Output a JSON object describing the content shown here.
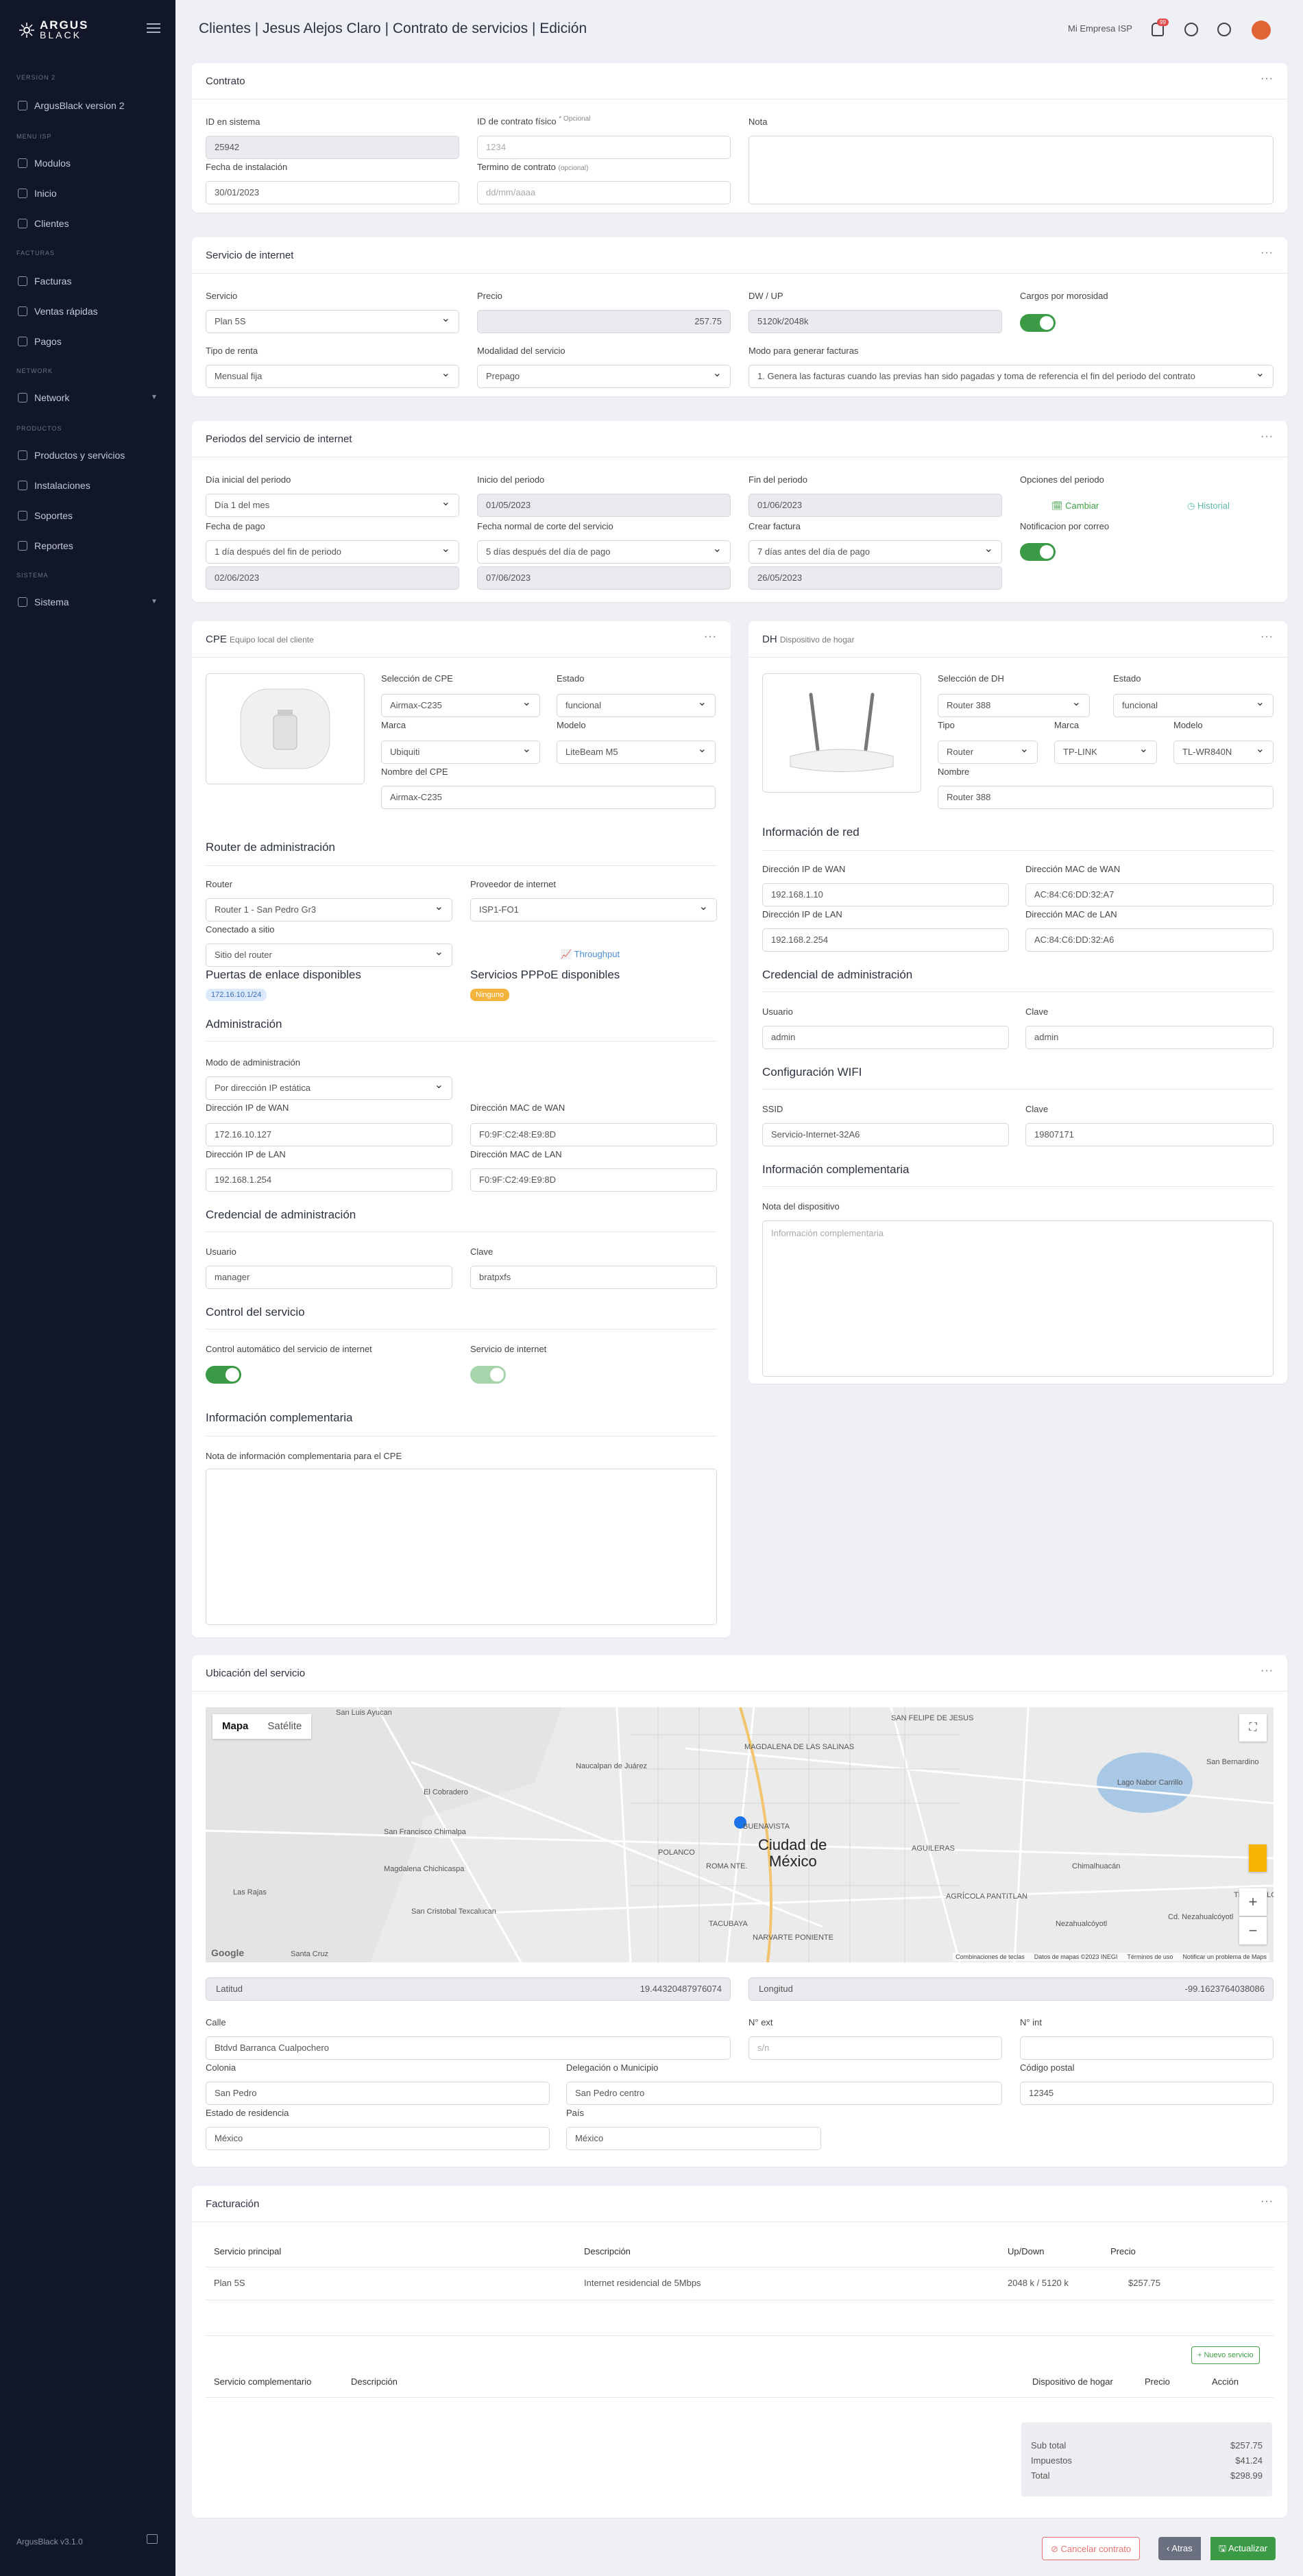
{
  "brand": {
    "name": "ARGUS",
    "sub": "BLACK"
  },
  "sidebar": {
    "sections": [
      "VERSION 2",
      "MENU ISP",
      "FACTURAS",
      "NETWORK",
      "PRODUCTOS",
      "SISTEMA"
    ],
    "items": [
      "ArgusBlack version 2",
      "Modulos",
      "Inicio",
      "Clientes",
      "Facturas",
      "Ventas rápidas",
      "Pagos",
      "Network",
      "Productos y servicios",
      "Instalaciones",
      "Soportes",
      "Reportes",
      "Sistema"
    ],
    "footer": "ArgusBlack v3.1.0"
  },
  "header": {
    "title": "Clientes | Jesus Alejos Claro | Contrato de servicios | Edición",
    "company": "Mi Empresa ISP",
    "notif_count": "99"
  },
  "contrato": {
    "title": "Contrato",
    "id_label": "ID en sistema",
    "id_value": "25942",
    "fisico_label": "ID de contrato físico",
    "fisico_opt": "* Opcional",
    "fisico_ph": "1234",
    "nota_label": "Nota",
    "fecha_label": "Fecha de instalación",
    "fecha_value": "30/01/2023",
    "termino_label": "Termino de contrato",
    "termino_opt": "(opcional)",
    "termino_ph": "dd/mm/aaaa"
  },
  "internet": {
    "title": "Servicio de internet",
    "servicio_label": "Servicio",
    "servicio_value": "Plan 5S",
    "precio_label": "Precio",
    "precio_value": "257.75",
    "dwup_label": "DW / UP",
    "dwup_value": "5120k/2048k",
    "cargos_label": "Cargos por morosidad",
    "renta_label": "Tipo de renta",
    "renta_value": "Mensual fija",
    "modalidad_label": "Modalidad del servicio",
    "modalidad_value": "Prepago",
    "modo_label": "Modo para generar facturas",
    "modo_value": "1. Genera las facturas cuando las previas han sido pagadas y toma de referencia el fin del periodo del contrato"
  },
  "periodos": {
    "title": "Periodos del servicio de internet",
    "dia_label": "Día inicial del periodo",
    "dia_value": "Día 1 del mes",
    "inicio_label": "Inicio del periodo",
    "inicio_value": "01/05/2023",
    "fin_label": "Fin del periodo",
    "fin_value": "01/06/2023",
    "opciones_label": "Opciones del periodo",
    "cambiar": "Cambiar",
    "historial": "Historial",
    "pago_label": "Fecha de pago",
    "pago_value": "1 día después del fin de periodo",
    "corte_label": "Fecha normal de corte del servicio",
    "corte_value": "5 días después del día de pago",
    "crear_label": "Crear factura",
    "crear_value": "7 días antes del día de pago",
    "notif_label": "Notificacion por correo",
    "pago_date": "02/06/2023",
    "corte_date": "07/06/2023",
    "crear_date": "26/05/2023"
  },
  "cpe": {
    "title": "CPE",
    "subtitle": "Equipo local del cliente",
    "sel_label": "Selección de CPE",
    "sel_value": "Airmax-C235",
    "estado_label": "Estado",
    "estado_value": "funcional",
    "marca_label": "Marca",
    "marca_value": "Ubiquiti",
    "modelo_label": "Modelo",
    "modelo_value": "LiteBeam M5",
    "nombre_label": "Nombre del CPE",
    "nombre_value": "Airmax-C235",
    "router_title": "Router de administración",
    "router_label": "Router",
    "router_value": "Router 1 - San Pedro Gr3",
    "proveedor_label": "Proveedor de internet",
    "proveedor_value": "ISP1-FO1",
    "conectado_label": "Conectado a sitio",
    "conectado_value": "Sitio del router",
    "throughput": "Throughput",
    "puertas_title": "Puertas de enlace disponibles",
    "puerta_value": "172.16.10.1/24",
    "pppoe_title": "Servicios PPPoE disponibles",
    "pppoe_value": "Ninguno",
    "admin_title": "Administración",
    "modo_label": "Modo de administración",
    "modo_value": "Por dirección IP estática",
    "wan_ip_label": "Dirección IP de WAN",
    "wan_ip": "172.16.10.127",
    "wan_mac_label": "Dirección MAC de WAN",
    "wan_mac": "F0:9F:C2:48:E9:8D",
    "lan_ip_label": "Dirección IP de LAN",
    "lan_ip": "192.168.1.254",
    "lan_mac_label": "Dirección MAC de LAN",
    "lan_mac": "F0:9F:C2:49:E9:8D",
    "cred_title": "Credencial de administración",
    "usuario_label": "Usuario",
    "usuario": "manager",
    "clave_label": "Clave",
    "clave": "bratpxfs",
    "control_title": "Control del servicio",
    "control_label": "Control automático del servicio de internet",
    "servicio_label": "Servicio de internet",
    "info_title": "Información complementaria",
    "info_label": "Nota de información complementaria para el CPE"
  },
  "dh": {
    "title": "DH",
    "subtitle": "Dispositivo de hogar",
    "sel_label": "Selección de DH",
    "sel_value": "Router 388",
    "estado_label": "Estado",
    "estado_value": "funcional",
    "tipo_label": "Tipo",
    "tipo_value": "Router",
    "marca_label": "Marca",
    "marca_value": "TP-LINK",
    "modelo_label": "Modelo",
    "modelo_value": "TL-WR840N",
    "nombre_label": "Nombre",
    "nombre_value": "Router 388",
    "red_title": "Información de red",
    "wan_ip_label": "Dirección IP de WAN",
    "wan_ip": "192.168.1.10",
    "wan_mac_label": "Dirección MAC de WAN",
    "wan_mac": "AC:84:C6:DD:32:A7",
    "lan_ip_label": "Dirección IP de LAN",
    "lan_ip": "192.168.2.254",
    "lan_mac_label": "Dirección MAC de LAN",
    "lan_mac": "AC:84:C6:DD:32:A6",
    "cred_title": "Credencial de administración",
    "usuario_label": "Usuario",
    "usuario": "admin",
    "clave_label": "Clave",
    "clave": "admin",
    "wifi_title": "Configuración WIFI",
    "ssid_label": "SSID",
    "ssid": "Servicio-Internet-32A6",
    "wclave_label": "Clave",
    "wclave": "19807171",
    "info_title": "Información complementaria",
    "nota_label": "Nota del dispositivo",
    "nota_ph": "Información complementaria"
  },
  "ubicacion": {
    "title": "Ubicación del servicio",
    "map_tab_map": "Mapa",
    "map_tab_sat": "Satélite",
    "city": "Ciudad de",
    "city2": "México",
    "google": "Google",
    "map_footer": [
      "Combinaciones de teclas",
      "Datos de mapas ©2023 INEGI",
      "Términos de uso",
      "Notificar un problema de Maps"
    ],
    "map_labels": [
      "San Luis Ayucan",
      "El Cobradero",
      "Naucalpan de Juárez",
      "San Francisco Chimalpa",
      "Magdalena Chichicaspa",
      "Las Rajas",
      "San Cristobal Texcalucan",
      "Santa Cruz",
      "MAGDALENA DE LAS SALINAS",
      "SAN FELIPE DE JESUS",
      "San Bernardino",
      "Chimalhuacán",
      "Nezahualcóyotl",
      "AGRÍCOLA PANTITLAN",
      "TACUBAYA",
      "NARVARTE PONIENTE",
      "ROMA NTE.",
      "BUENAVISTA",
      "Lago Nabor Carrillo",
      "POLANCO",
      "AGUILERAS",
      "TLATELOLCO",
      "Cd. Nezahualcóyotl"
    ],
    "lat_label": "Latitud",
    "lat": "19.44320487976074",
    "lng_label": "Longitud",
    "lng": "-99.1623764038086",
    "calle_label": "Calle",
    "calle": "Btdvd Barranca Cualpochero",
    "ext_label": "N° ext",
    "ext_ph": "s/n",
    "int_label": "N° int",
    "colonia_label": "Colonia",
    "colonia": "San Pedro",
    "deleg_label": "Delegación o Municipio",
    "deleg": "San Pedro centro",
    "cp_label": "Código postal",
    "cp": "12345",
    "estado_label": "Estado de residencia",
    "estado": "México",
    "pais_label": "País",
    "pais": "México"
  },
  "facturacion": {
    "title": "Facturación",
    "headers": [
      "Servicio principal",
      "Descripción",
      "Up/Down",
      "Precio"
    ],
    "row": [
      "Plan 5S",
      "Internet residencial de 5Mbps",
      "2048 k / 5120 k",
      "$257.75"
    ],
    "nuevo": "Nuevo servicio",
    "headers2": [
      "Servicio complementario",
      "Descripción",
      "Dispositivo de hogar",
      "Precio",
      "Acción"
    ],
    "subtotal_label": "Sub total",
    "subtotal": "$257.75",
    "impuestos_label": "Impuestos",
    "impuestos": "$41.24",
    "total_label": "Total",
    "total": "$298.99"
  },
  "actions": {
    "cancel": "Cancelar contrato",
    "back": "Atras",
    "update": "Actualizar"
  }
}
